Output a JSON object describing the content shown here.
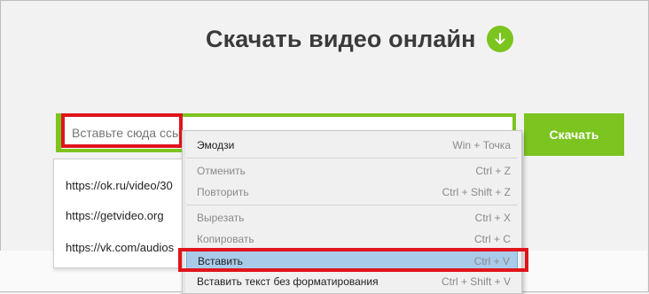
{
  "page": {
    "title": "Скачать видео онлайн",
    "download_icon": "arrow-down-icon",
    "accent_color": "#7cc41f",
    "highlight_color": "#e0141b"
  },
  "search": {
    "placeholder": "Вставьте сюда ссылку",
    "visible_placeholder": "Вставьте сюда ссы",
    "submit_label": "Скачать"
  },
  "autocomplete": {
    "items": [
      {
        "label": "https://ok.ru/video/30"
      },
      {
        "label": "https://getvideo.org"
      },
      {
        "label": "https://vk.com/audios"
      }
    ]
  },
  "context_menu": {
    "items": [
      {
        "label": "Эмодзи",
        "shortcut": "Win + Точка"
      },
      {
        "label": "Отменить",
        "shortcut": "Ctrl + Z"
      },
      {
        "label": "Повторить",
        "shortcut": "Ctrl + Shift + Z"
      },
      {
        "label": "Вырезать",
        "shortcut": "Ctrl + X"
      },
      {
        "label": "Копировать",
        "shortcut": "Ctrl + C"
      },
      {
        "label": "Вставить",
        "shortcut": "Ctrl + V"
      },
      {
        "label": "Вставить текст без форматирования",
        "shortcut": "Ctrl + Shift + V"
      }
    ]
  }
}
